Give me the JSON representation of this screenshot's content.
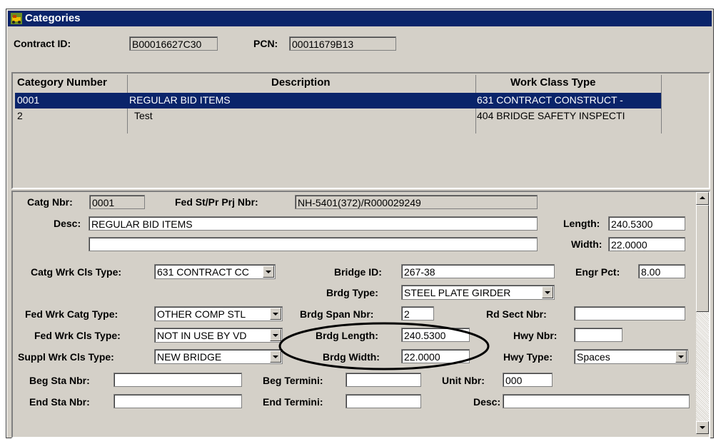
{
  "window": {
    "title": "Categories"
  },
  "header": {
    "contract_id_label": "Contract ID:",
    "contract_id_value": "B00016627C30",
    "pcn_label": "PCN:",
    "pcn_value": "00011679B13"
  },
  "grid": {
    "columns": [
      "Category Number",
      "Description",
      "Work Class Type"
    ],
    "rows": [
      {
        "number": "0001",
        "description": "REGULAR BID ITEMS",
        "work_class": "631 CONTRACT CONSTRUCT -",
        "selected": true
      },
      {
        "number": "2",
        "description": "Test",
        "work_class": "404 BRIDGE SAFETY INSPECTI",
        "selected": false
      }
    ]
  },
  "detail": {
    "catg_nbr_label": "Catg Nbr:",
    "catg_nbr": "0001",
    "fed_prj_label": "Fed St/Pr Prj Nbr:",
    "fed_prj": "NH-5401(372)/R000029249",
    "desc_label": "Desc:",
    "desc": "REGULAR BID ITEMS",
    "desc2": "",
    "length_label": "Length:",
    "length": "240.5300",
    "width_label": "Width:",
    "width": "22.0000",
    "catg_wrk_cls_label": "Catg Wrk Cls Type:",
    "catg_wrk_cls": "631 CONTRACT CC",
    "bridge_id_label": "Bridge ID:",
    "bridge_id": "267-38",
    "engr_pct_label": "Engr Pct:",
    "engr_pct": "8.00",
    "brdg_type_label": "Brdg Type:",
    "brdg_type": "STEEL PLATE GIRDER",
    "fed_wrk_catg_label": "Fed Wrk Catg Type:",
    "fed_wrk_catg": "OTHER COMP STL",
    "brdg_span_label": "Brdg Span Nbr:",
    "brdg_span": "2",
    "rd_sect_label": "Rd Sect Nbr:",
    "rd_sect": "",
    "fed_wrk_cls_label": "Fed Wrk Cls Type:",
    "fed_wrk_cls": "NOT IN USE BY VD",
    "brdg_length_label": "Brdg Length:",
    "brdg_length": "240.5300",
    "hwy_nbr_label": "Hwy Nbr:",
    "hwy_nbr": "",
    "suppl_wrk_cls_label": "Suppl Wrk Cls Type:",
    "suppl_wrk_cls": "NEW BRIDGE",
    "brdg_width_label": "Brdg Width:",
    "brdg_width": "22.0000",
    "hwy_type_label": "Hwy Type:",
    "hwy_type": "Spaces",
    "beg_sta_label": "Beg Sta Nbr:",
    "beg_sta": "",
    "beg_termini_label": "Beg Termini:",
    "beg_termini": "",
    "unit_nbr_label": "Unit Nbr:",
    "unit_nbr": "000",
    "end_sta_label": "End Sta Nbr:",
    "end_sta": "",
    "end_termini_label": "End Termini:",
    "end_termini": "",
    "desc_bottom_label": "Desc:",
    "desc_bottom": ""
  },
  "colors": {
    "titlebar": "#0a246a",
    "selection": "#0a246a",
    "face": "#d4d0c8"
  }
}
